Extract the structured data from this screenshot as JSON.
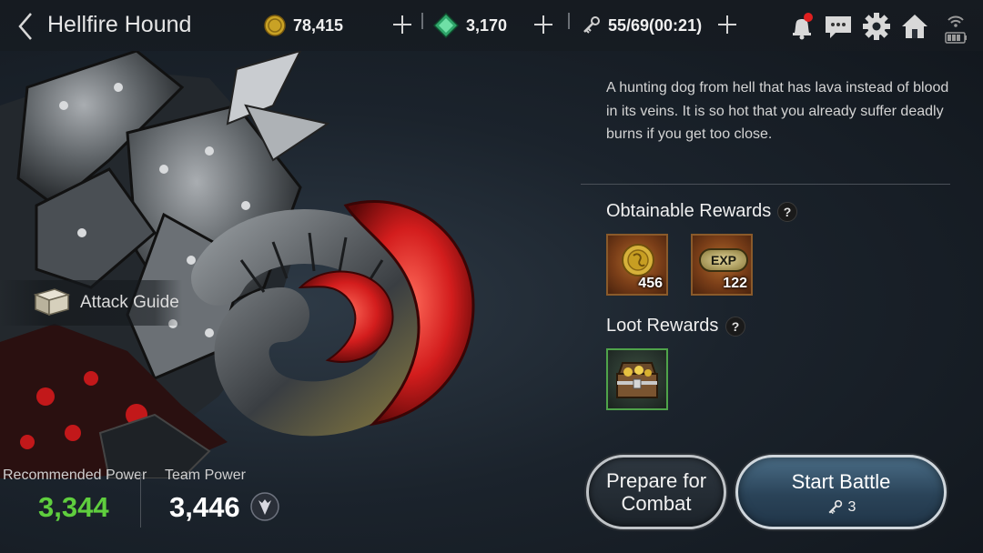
{
  "header": {
    "title": "Hellfire Hound",
    "gold": "78,415",
    "gems": "3,170",
    "stamina": "55/69(00:21)"
  },
  "creature": {
    "description": "A hunting dog from hell that has lava instead of blood in its veins. It is so hot that you already suffer deadly burns if you get too close."
  },
  "attack_guide": {
    "label": "Attack Guide"
  },
  "power": {
    "recommended_label": "Recommended Power",
    "recommended_value": "3,344",
    "team_label": "Team Power",
    "team_value": "3,446"
  },
  "rewards": {
    "obtainable_title": "Obtainable Rewards",
    "items": [
      {
        "icon": "gold-coin-icon",
        "quantity": "456"
      },
      {
        "icon": "exp-badge-icon",
        "label": "EXP",
        "quantity": "122"
      }
    ],
    "loot_title": "Loot Rewards",
    "loot_items": [
      {
        "icon": "treasure-chest-icon"
      }
    ],
    "help_glyph": "?"
  },
  "buttons": {
    "prepare_label": "Prepare for Combat",
    "start_label": "Start Battle",
    "start_cost": "3"
  },
  "colors": {
    "recommended_power": "#5fce3e",
    "accent_blue": "#2a4358",
    "loot_border": "#4fa34a",
    "reward_border": "#8a5a2a"
  }
}
